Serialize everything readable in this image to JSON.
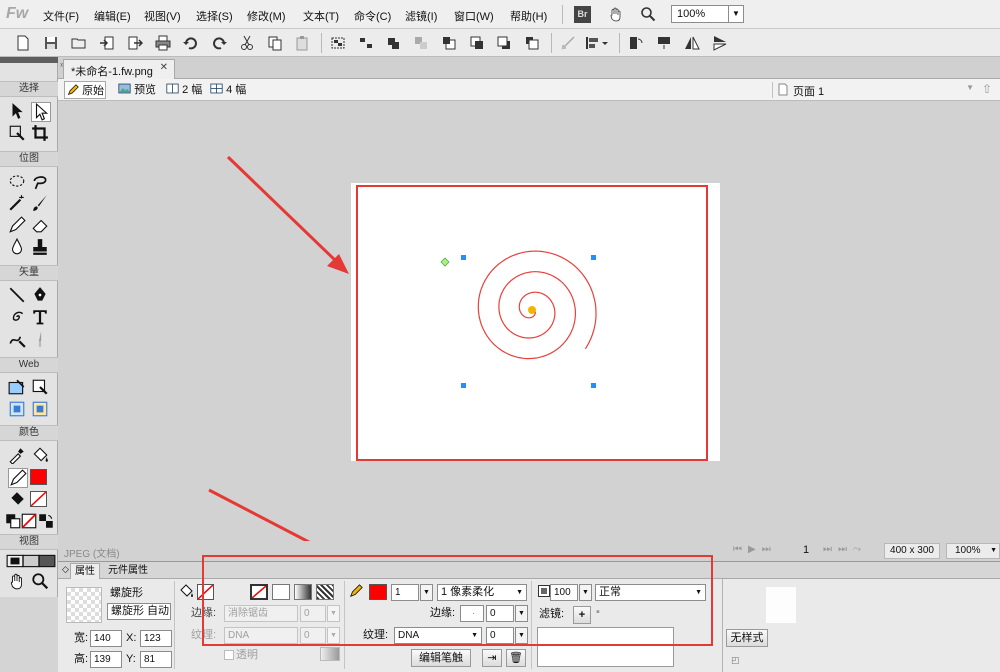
{
  "app": {
    "logo": "Fw"
  },
  "menu": [
    "文件(F)",
    "编辑(E)",
    "视图(V)",
    "选择(S)",
    "修改(M)",
    "文本(T)",
    "命令(C)",
    "滤镜(I)",
    "窗口(W)",
    "帮助(H)"
  ],
  "menu_right": {
    "bridge": "Br",
    "zoom": "100%"
  },
  "document": {
    "tab": "*未命名-1.fw.png"
  },
  "viewbar": {
    "original": "原始",
    "preview": "预览",
    "two_up": "2 幅",
    "four_up": "4 幅",
    "page": "页面 1"
  },
  "tools": {
    "sections": [
      "选择",
      "位图",
      "矢量",
      "Web",
      "颜色",
      "视图"
    ],
    "stroke_color": "#ff0000",
    "fill_color": "#ff0000"
  },
  "status": {
    "format": "JPEG (文档)",
    "page_num": "1",
    "size": "400 x 300",
    "zoom": "100%"
  },
  "props": {
    "tabs": [
      "属性",
      "元件属性"
    ],
    "object_type": "螺旋形",
    "object_name": "螺旋形 自动",
    "width_label": "宽:",
    "width": "140",
    "height_label": "高:",
    "height": "139",
    "x_label": "X:",
    "x": "123",
    "y_label": "Y:",
    "y": "81",
    "fill": {
      "edge_label": "边缘:",
      "edge_value": "消除锯齿",
      "edge_num": "0",
      "texture_label": "纹理:",
      "texture_value": "DNA",
      "texture_num": "0",
      "transparent_label": "透明"
    },
    "stroke": {
      "color": "#ff0000",
      "size": "1",
      "type": "1 像素柔化",
      "edge_label": "边缘:",
      "edge_num": "0",
      "texture_label": "纹理:",
      "texture_value": "DNA",
      "texture_num": "0",
      "edit_button": "编辑笔触"
    },
    "opacity": "100",
    "blend": "正常",
    "filter_label": "滤镜:",
    "style": "无样式"
  },
  "colors": {
    "accent_red": "#e53935",
    "handle_blue": "#1e90ff",
    "spiral": "#e8403a"
  }
}
